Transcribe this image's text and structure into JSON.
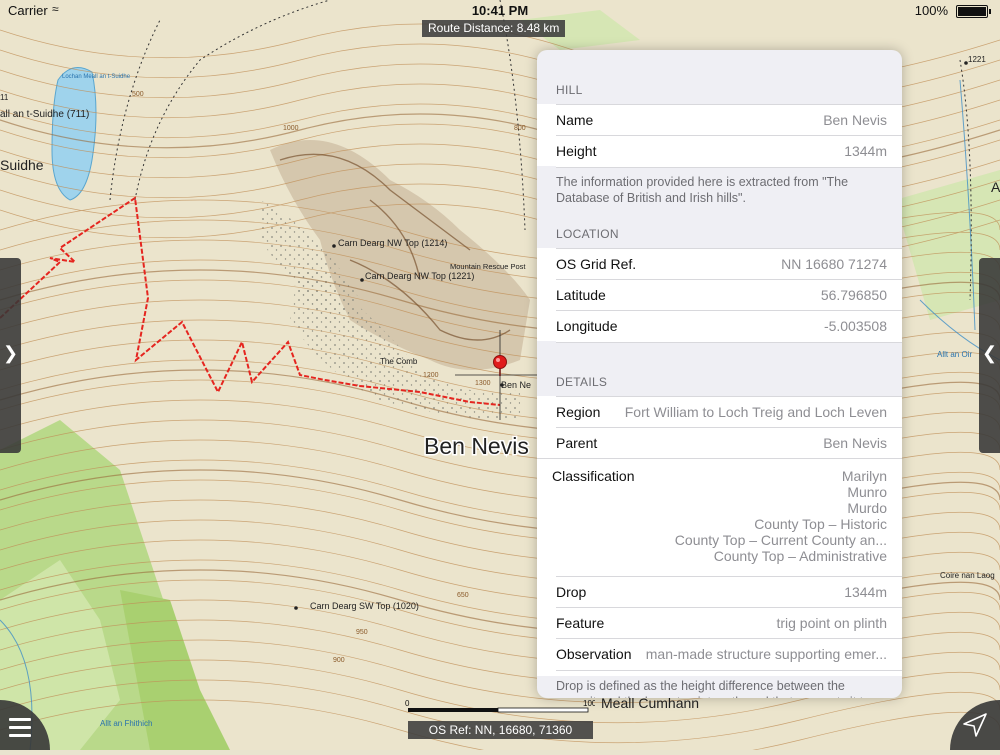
{
  "status_bar": {
    "carrier": "Carrier",
    "time": "10:41 PM",
    "battery": "100%"
  },
  "route_distance": "Route Distance: 8.48 km",
  "os_ref": "OS Ref: NN, 16680, 71360",
  "scale_label": "1000m",
  "scale_zero": "0",
  "map_labels": {
    "main": "Ben Nevis",
    "ben_ne": "Ben Ne",
    "suidhe": "Suidhe",
    "loch_left": "all an t-Suidhe (711)",
    "loch_label": "Lochan Meall an t-Suidhe",
    "carn_nw1": "Carn Dearg NW Top (1214)",
    "carn_nw2": "Carn Dearg NW Top (1221)",
    "mountain_rescue": "Mountain Rescue Post",
    "the_comb": "The Comb",
    "carn_sw": "Carn Dearg SW Top (1020)",
    "meall": "Meall Cumhann",
    "allt_fhithich": "Allt an Fhithich",
    "allt_oir": "Allt an Oir",
    "coire": "Coire nan Laog",
    "c1221": "1221",
    "c900": "900",
    "c950": "950",
    "c650": "650",
    "c1000": "1000",
    "c1200": "1200",
    "c1300": "1300",
    "c800": "800",
    "c500": "500",
    "cA": "A",
    "c11": "11",
    "a_right": "A"
  },
  "colors": {
    "route": "#e5251f",
    "pin": "#e01b1b",
    "pill": "#3c3c3c"
  },
  "panel": {
    "hill": {
      "header": "HILL",
      "name_label": "Name",
      "name_value": "Ben Nevis",
      "height_label": "Height",
      "height_value": "1344m",
      "note": "The information provided here is extracted from \"The Database of British and Irish hills\"."
    },
    "location": {
      "header": "LOCATION",
      "grid_label": "OS Grid Ref.",
      "grid_value": "NN 16680 71274",
      "lat_label": "Latitude",
      "lat_value": "56.796850",
      "lon_label": "Longitude",
      "lon_value": "-5.003508"
    },
    "details": {
      "header": "DETAILS",
      "region_label": "Region",
      "region_value": "Fort William to Loch Treig and Loch Leven",
      "parent_label": "Parent",
      "parent_value": "Ben Nevis",
      "classification_label": "Classification",
      "classification": [
        "Marilyn",
        "Munro",
        "Murdo",
        "County Top – Historic",
        "County Top – Current County an...",
        "County Top – Administrative"
      ],
      "drop_label": "Drop",
      "drop_value": "1344m",
      "feature_label": "Feature",
      "feature_value": "trig point on plinth",
      "observation_label": "Observation",
      "observation_value": "man-made structure supporting emer...",
      "footnote": "Drop is defined as the height difference between the summit and the lowest point on the col that connects it to a higher"
    }
  },
  "icons": {
    "menu": "menu-icon",
    "location": "location-arrow-icon",
    "left_handle": "chevron-right-icon",
    "right_handle": "chevron-left-icon",
    "pin": "map-pin-icon"
  }
}
